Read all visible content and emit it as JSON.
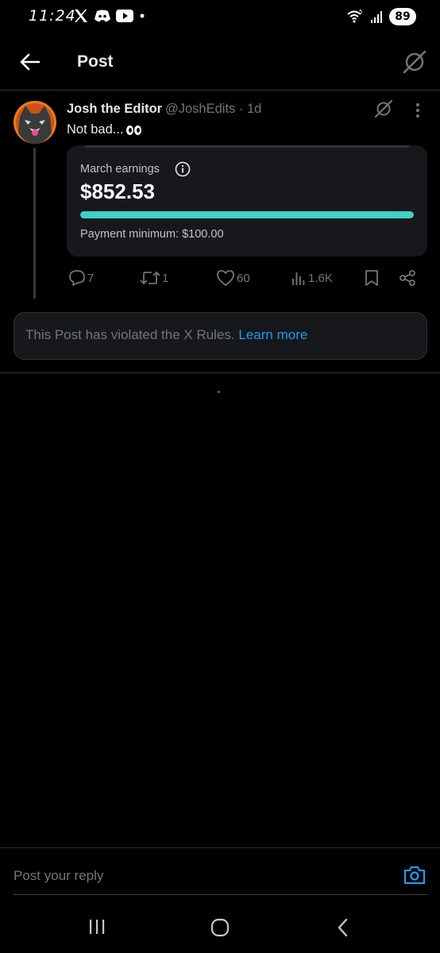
{
  "status_bar": {
    "time": "11:24",
    "battery": "89",
    "wifi_badge": "5"
  },
  "header": {
    "title": "Post"
  },
  "post": {
    "author_name": "Josh the Editor",
    "author_handle": "@JoshEdits",
    "age": "1d",
    "text": "Not bad...",
    "card": {
      "label": "March earnings",
      "amount": "$852.53",
      "progress_fraction": 1.0,
      "minimum": "Payment minimum: $100.00",
      "accent_color": "#3fd2c4"
    },
    "actions": {
      "replies": "7",
      "reposts": "1",
      "likes": "60",
      "views": "1.6K"
    }
  },
  "violation": {
    "text": "This Post has violated the X Rules.",
    "link": "Learn more",
    "link_color": "#1d9bf0"
  },
  "reply": {
    "placeholder": "Post your reply"
  }
}
